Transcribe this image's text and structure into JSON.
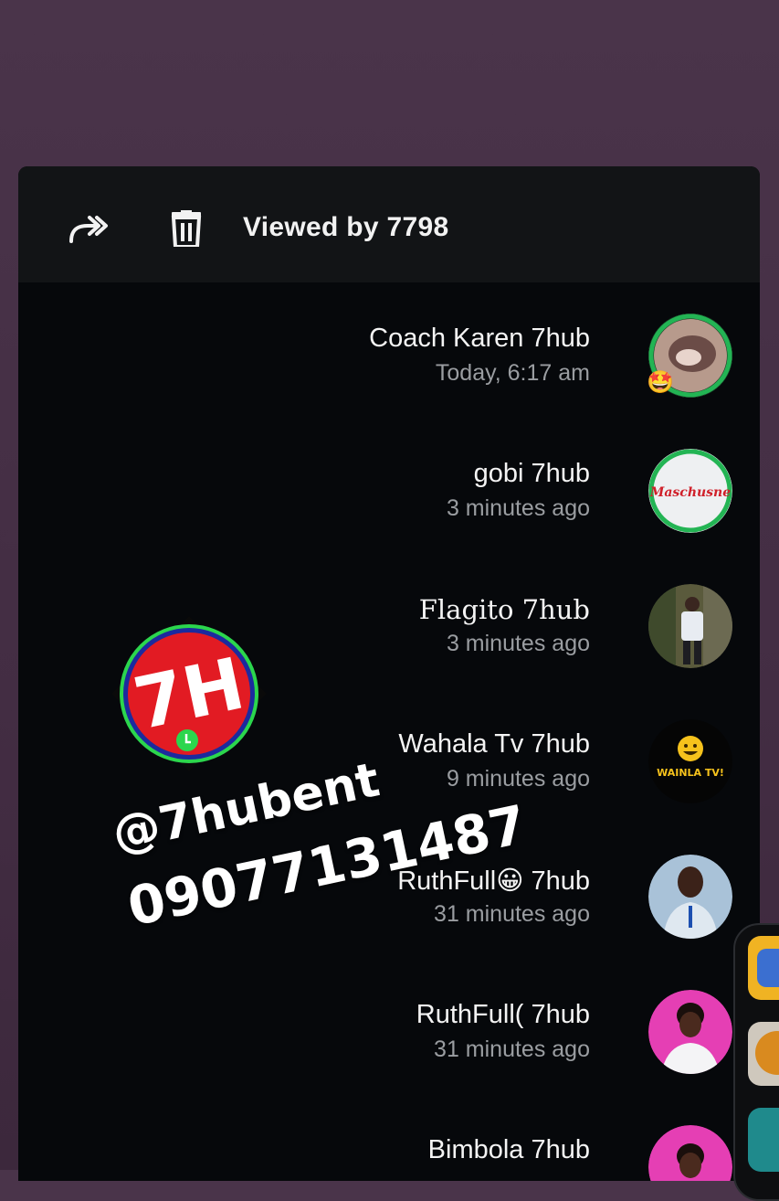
{
  "header": {
    "title": "Viewed by 7798",
    "forward_icon": "forward-icon",
    "delete_icon": "trash-icon"
  },
  "viewers": [
    {
      "name": "Coach Karen 7hub",
      "time": "Today, 6:17 am",
      "reaction": "🤩",
      "ring": true
    },
    {
      "name": "gobi 7hub",
      "time": "3 minutes ago",
      "ring": true
    },
    {
      "name": "Flagito 7hub",
      "time": "3 minutes ago",
      "ring": false
    },
    {
      "name": "Wahala Tv 7hub",
      "time": "9 minutes ago",
      "ring": false
    },
    {
      "name": "RuthFull😀 7hub",
      "time": "31 minutes ago",
      "ring": false
    },
    {
      "name": "RuthFull( 7hub",
      "time": "31 minutes ago",
      "ring": false
    },
    {
      "name": "Bimbola 7hub",
      "time": "",
      "ring": false
    }
  ],
  "avatar_text": {
    "gobi": "Maschusne",
    "wahala": "WAINLA TV!"
  },
  "watermark": {
    "logo_text": "7H",
    "handle": "@7hubent",
    "phone": "09077131487"
  },
  "colors": {
    "background": "#4a344a",
    "sheet": "#06080b",
    "header": "#121416",
    "ring": "#23b454",
    "secondary_text": "#9a9da1"
  }
}
